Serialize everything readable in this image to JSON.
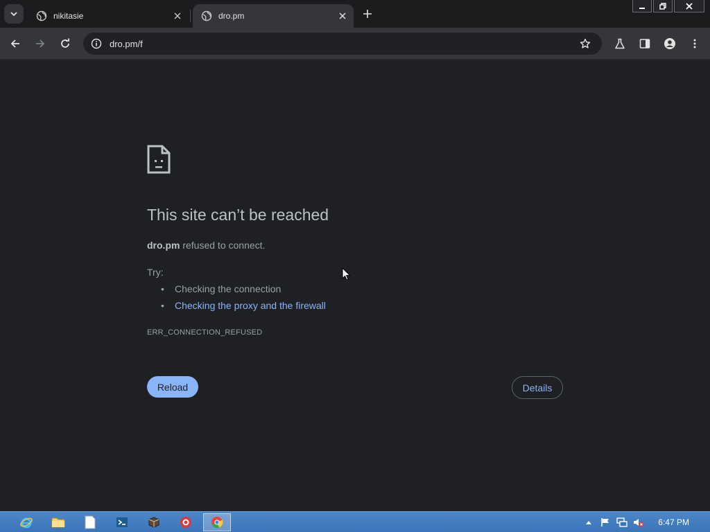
{
  "tabs": [
    {
      "title": "nikitasie",
      "active": false
    },
    {
      "title": "dro.pm",
      "active": true
    }
  ],
  "toolbar": {
    "url": "dro.pm/f"
  },
  "error": {
    "title": "This site can’t be reached",
    "host": "dro.pm",
    "description_suffix": " refused to connect.",
    "try_label": "Try:",
    "suggestions": [
      "Checking the connection",
      "Checking the proxy and the firewall"
    ],
    "code": "ERR_CONNECTION_REFUSED",
    "reload_label": "Reload",
    "details_label": "Details"
  },
  "taskbar": {
    "apps": [
      "internet-explorer",
      "file-explorer",
      "notepad",
      "terminal",
      "package-app",
      "red-app",
      "chrome"
    ],
    "clock": "6:47 PM"
  },
  "colors": {
    "page_bg": "#1f2023",
    "toolbar_bg": "#35363a",
    "link_blue": "#8ab4f8",
    "text_muted": "#9aa0a6",
    "taskbar_blue": "#3b74b8"
  }
}
